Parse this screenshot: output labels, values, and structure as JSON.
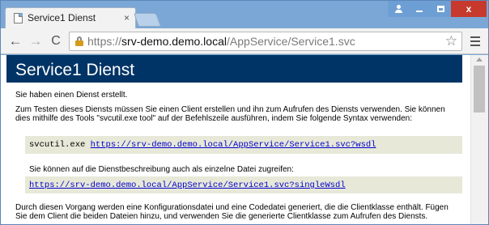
{
  "tab": {
    "title": "Service1 Dienst",
    "close_glyph": "×",
    "favicon": "page-icon"
  },
  "toolbar": {
    "back_glyph": "←",
    "forward_glyph": "→",
    "reload_glyph": "C",
    "url_scheme": "https://",
    "url_host": "srv-demo.demo.local",
    "url_path": "/AppService/Service1.svc",
    "star_glyph": "☆"
  },
  "window": {
    "close_glyph": "x"
  },
  "page": {
    "heading": "Service1 Dienst",
    "p1": "Sie haben einen Dienst erstellt.",
    "p2": "Zum Testen dieses Diensts müssen Sie einen Client erstellen und ihn zum Aufrufen des Diensts verwenden. Sie können",
    "p3": "dies mithilfe des Tools \"svcutil.exe tool\" auf der Befehlszeile ausführen, indem Sie folgende Syntax verwenden:",
    "code1_prefix": "svcutil.exe ",
    "code1_link": "https://srv-demo.demo.local/AppService/Service1.svc?wsdl",
    "p4": "Sie können auf die Dienstbeschreibung auch als einzelne Datei zugreifen:",
    "code2_link": "https://srv-demo.demo.local/AppService/Service1.svc?singleWsdl",
    "p5": "Durch diesen Vorgang werden eine Konfigurationsdatei und eine Codedatei generiert, die die Clientklasse enthält. Fügen",
    "p6": "Sie dem Client die beiden Dateien hinzu, und verwenden Sie die generierte Clientklasse zum Aufrufen des Diensts."
  },
  "colors": {
    "heading_band": "#003366",
    "code_bg": "#e8e8d8",
    "link": "#0000cc",
    "titlebar": "#7aa7d6",
    "close_button": "#c7392c"
  }
}
